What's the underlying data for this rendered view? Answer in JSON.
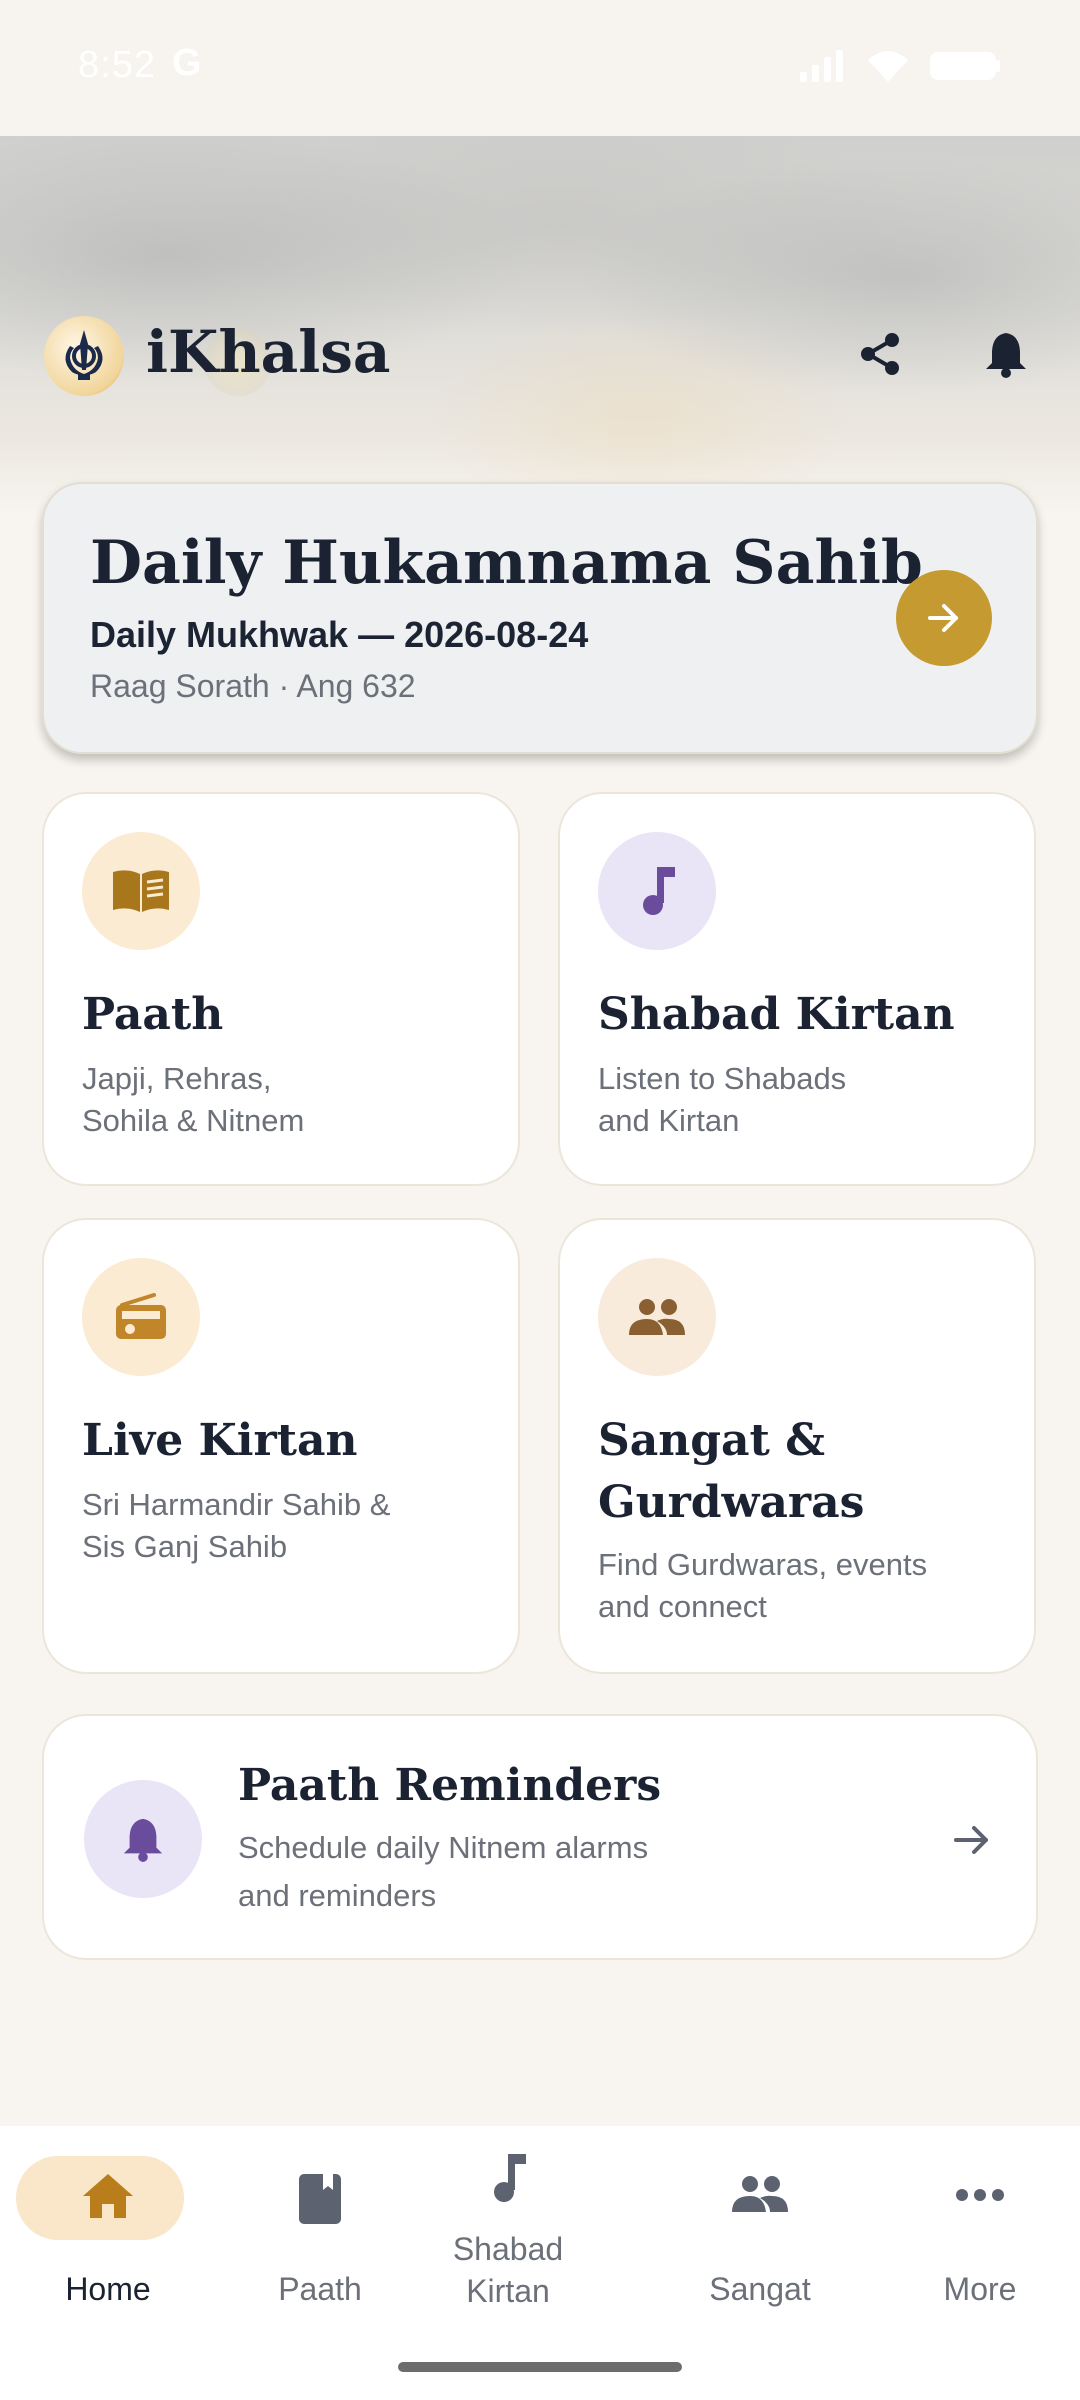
{
  "status_bar": {
    "time": "8:52",
    "carrier_icon": "G"
  },
  "header": {
    "app_title": "iKhalsa",
    "share_icon": "share-icon",
    "notification_icon": "bell-icon"
  },
  "hukamnama": {
    "title": "Daily Hukamnama Sahib",
    "subtitle": "Daily Mukhwak — 2026-08-24",
    "meta": "Raag Sorath · Ang 632"
  },
  "tiles": [
    {
      "title": "Paath",
      "desc_line1": "Japji, Rehras,",
      "desc_line2": "Sohila & Nitnem",
      "icon": "book-open-icon",
      "icon_bg": "#fcebd3",
      "icon_color": "#a8761b"
    },
    {
      "title": "Shabad Kirtan",
      "desc_line1": "Listen to Shabads",
      "desc_line2": "and Kirtan",
      "icon": "music-note-icon",
      "icon_bg": "#e9e4f6",
      "icon_color": "#6a4c9c"
    },
    {
      "title": "Live Kirtan",
      "desc_line1": "Sri Harmandir Sahib &",
      "desc_line2": "Sis Ganj Sahib",
      "icon": "radio-icon",
      "icon_bg": "#fcebd3",
      "icon_color": "#c1852a"
    },
    {
      "title_line1": "Sangat &",
      "title_line2": "Gurdwaras",
      "desc_line1": "Find Gurdwaras, events",
      "desc_line2": "and connect",
      "icon": "people-icon",
      "icon_bg": "#f8ebdc",
      "icon_color": "#8a6032"
    }
  ],
  "reminders": {
    "title": "Paath Reminders",
    "desc_line1": "Schedule daily Nitnem alarms",
    "desc_line2": "and reminders",
    "icon": "bell-icon"
  },
  "bottom_nav": [
    {
      "label": "Home",
      "icon": "home-icon",
      "active": true
    },
    {
      "label": "Paath",
      "icon": "book-icon",
      "active": false
    },
    {
      "label_line1": "Shabad",
      "label_line2": "Kirtan",
      "icon": "music-note-icon",
      "active": false
    },
    {
      "label": "Sangat",
      "icon": "people-icon",
      "active": false
    },
    {
      "label": "More",
      "icon": "more-icon",
      "active": false
    }
  ],
  "colors": {
    "accent": "#c59a31",
    "background": "#f8f5f0",
    "text": "#1b2333",
    "muted": "#6c7079"
  }
}
